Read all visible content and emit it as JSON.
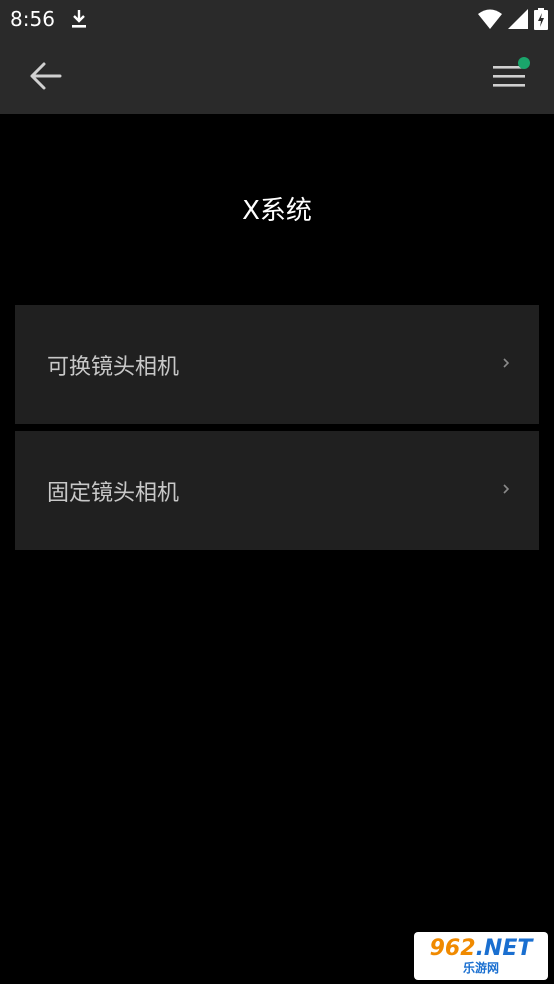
{
  "status_bar": {
    "time": "8:56",
    "icons": [
      "download-icon",
      "wifi-icon",
      "signal-icon",
      "battery-charging-icon"
    ]
  },
  "app_bar": {
    "back_icon": "arrow-left-icon",
    "menu_icon": "hamburger-menu-icon",
    "notification_dot_color": "#1aa56b"
  },
  "page": {
    "title": "X系统"
  },
  "list": {
    "items": [
      {
        "label": "可换镜头相机",
        "icon": "chevron-right-icon"
      },
      {
        "label": "固定镜头相机",
        "icon": "chevron-right-icon"
      }
    ]
  },
  "watermark": {
    "number": "962",
    "domain": ".NET",
    "subtitle": "乐游网"
  },
  "colors": {
    "background": "#000000",
    "bar": "#2a2a2a",
    "card": "#202020",
    "text_primary": "#ffffff",
    "text_secondary": "#c8c8c8"
  }
}
